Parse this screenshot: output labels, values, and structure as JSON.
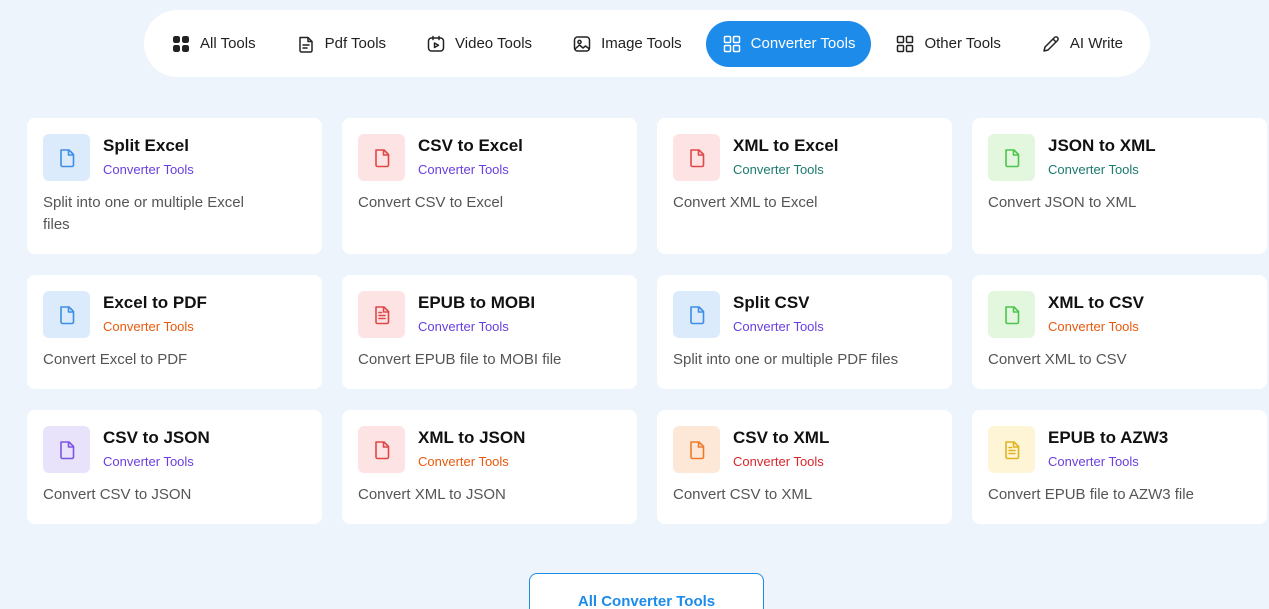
{
  "tabs": [
    {
      "label": "All Tools",
      "icon": "grid-dots-icon",
      "active": false
    },
    {
      "label": "Pdf Tools",
      "icon": "pdf-file-icon",
      "active": false
    },
    {
      "label": "Video Tools",
      "icon": "video-icon",
      "active": false
    },
    {
      "label": "Image Tools",
      "icon": "image-icon",
      "active": false
    },
    {
      "label": "Converter Tools",
      "icon": "grid-squares-icon",
      "active": true
    },
    {
      "label": "Other Tools",
      "icon": "grid-squares-icon",
      "active": false
    },
    {
      "label": "AI Write",
      "icon": "pen-icon",
      "active": false
    }
  ],
  "colors": {
    "accent": "#1d8bea",
    "page_bg": "#eef4fc"
  },
  "cards": [
    {
      "title": "Split Excel",
      "category": "Converter Tools",
      "cat_color": "#6a3fe0",
      "desc": "Split into one or multiple Excel files",
      "icon": "file-icon",
      "icon_bg": "#dcebfb",
      "icon_color": "#3d8ee6"
    },
    {
      "title": "CSV to Excel",
      "category": "Converter Tools",
      "cat_color": "#6a3fe0",
      "desc": "Convert CSV to Excel",
      "icon": "file-icon",
      "icon_bg": "#fde3e3",
      "icon_color": "#e04848"
    },
    {
      "title": "XML to Excel",
      "category": "Converter Tools",
      "cat_color": "#1b7a6e",
      "desc": "Convert XML to Excel",
      "icon": "file-icon",
      "icon_bg": "#fde3e3",
      "icon_color": "#e04848"
    },
    {
      "title": "JSON to XML",
      "category": "Converter Tools",
      "cat_color": "#1b7a6e",
      "desc": "Convert JSON to XML",
      "icon": "file-icon",
      "icon_bg": "#e3f7df",
      "icon_color": "#4cc54a"
    },
    {
      "title": "Excel to PDF",
      "category": "Converter Tools",
      "cat_color": "#e8590c",
      "desc": "Convert Excel to PDF",
      "icon": "file-icon",
      "icon_bg": "#dcebfb",
      "icon_color": "#3d8ee6"
    },
    {
      "title": "EPUB to MOBI",
      "category": "Converter Tools",
      "cat_color": "#6a3fe0",
      "desc": "Convert EPUB file to MOBI file",
      "icon": "file-text-icon",
      "icon_bg": "#fde3e3",
      "icon_color": "#e04848"
    },
    {
      "title": "Split CSV",
      "category": "Converter Tools",
      "cat_color": "#6a3fe0",
      "desc": "Split into one or multiple PDF files",
      "icon": "file-icon",
      "icon_bg": "#dcebfb",
      "icon_color": "#3d8ee6"
    },
    {
      "title": "XML to CSV",
      "category": "Converter Tools",
      "cat_color": "#e8590c",
      "desc": "Convert XML to CSV",
      "icon": "file-icon",
      "icon_bg": "#e3f7df",
      "icon_color": "#4cc54a"
    },
    {
      "title": "CSV to JSON",
      "category": "Converter Tools",
      "cat_color": "#6a3fe0",
      "desc": "Convert CSV to JSON",
      "icon": "file-icon",
      "icon_bg": "#e8e3fb",
      "icon_color": "#7b55e6"
    },
    {
      "title": "XML to JSON",
      "category": "Converter Tools",
      "cat_color": "#e8590c",
      "desc": "Convert XML to JSON",
      "icon": "file-icon",
      "icon_bg": "#fde3e3",
      "icon_color": "#e04848"
    },
    {
      "title": "CSV to XML",
      "category": "Converter Tools",
      "cat_color": "#d9262b",
      "desc": "Convert CSV to XML",
      "icon": "file-icon",
      "icon_bg": "#fde8d8",
      "icon_color": "#f07a2a"
    },
    {
      "title": "EPUB to AZW3",
      "category": "Converter Tools",
      "cat_color": "#6a3fe0",
      "desc": "Convert EPUB file to AZW3 file",
      "icon": "file-text-icon",
      "icon_bg": "#fdf5d6",
      "icon_color": "#e0b321"
    }
  ],
  "all_button_label": "All Converter Tools"
}
